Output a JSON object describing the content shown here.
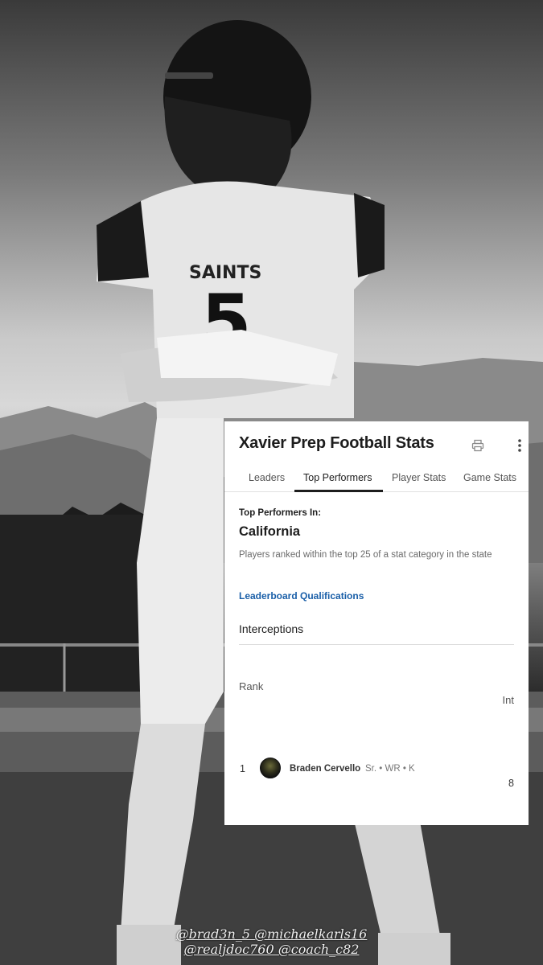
{
  "card": {
    "title": "Xavier Prep Football Stats",
    "icons": {
      "print": "print-icon",
      "more": "more-vertical-icon"
    },
    "tabs": [
      {
        "label": "Leaders"
      },
      {
        "label": "Top Performers"
      },
      {
        "label": "Player Stats"
      },
      {
        "label": "Game Stats"
      }
    ],
    "active_tab": "Top Performers",
    "section_label": "Top Performers In:",
    "region": "California",
    "description": "Players ranked within the top 25 of a stat category in the state",
    "link_label": "Leaderboard Qualifications",
    "category": "Interceptions",
    "table": {
      "col_rank": "Rank",
      "col_value": "Int",
      "rows": [
        {
          "rank": "1",
          "name": "Braden Cervello",
          "meta": "Sr. • WR • K",
          "value": "8"
        }
      ]
    }
  },
  "caption": {
    "line1": "@brad3n_5 @michaelkarls16",
    "line2": "@realjdoc760 @coach_c82"
  },
  "jersey": {
    "team": "SAINTS",
    "number": "5"
  }
}
